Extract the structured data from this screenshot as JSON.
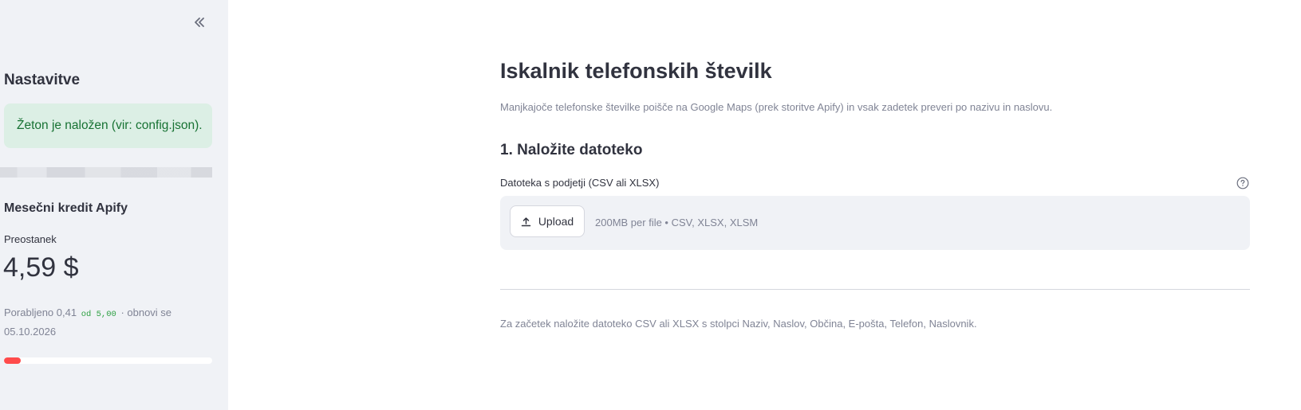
{
  "sidebar": {
    "collapse_label": "«",
    "heading": "Nastavitve",
    "token_alert": "Žeton je naložen (vir: config.json).",
    "credit": {
      "heading": "Mesečni kredit Apify",
      "metric_label": "Preostanek",
      "metric_value": "4,59 $",
      "used_prefix": "Porabljeno 0,41",
      "used_of": "od 5,00",
      "renew_text": "· obnovi se 05.10.2026",
      "used_fraction": 0.082,
      "bar_color": "#ff4b4b"
    }
  },
  "main": {
    "title": "Iskalnik telefonskih številk",
    "subtitle": "Manjkajoče telefonske številke poišče na Google Maps (prek storitve Apify) in vsak zadetek preveri po nazivu in naslovu.",
    "section_title": "1. Naložite datoteko",
    "uploader": {
      "label": "Datoteka s podjetji (CSV ali XLSX)",
      "button_label": "Upload",
      "limits": "200MB per file • CSV, XLSX, XLSM",
      "help_icon": "question-circle-icon",
      "upload_icon": "upload-icon"
    },
    "info": "Za začetek naložite datoteko CSV ali XLSX s stolpci Naziv, Naslov, Občina, E-pošta, Telefon, Naslovnik."
  },
  "colors": {
    "sidebar_bg": "#f0f2f6",
    "success_bg": "#dcefe5",
    "success_text": "#177233",
    "progress": "#ff4b4b"
  }
}
